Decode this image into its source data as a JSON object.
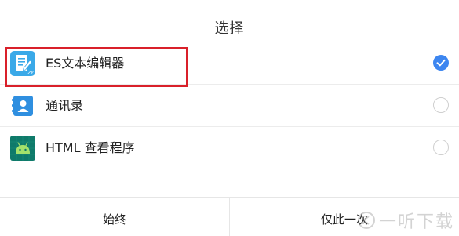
{
  "dialog": {
    "title": "选择"
  },
  "apps": [
    {
      "label": "ES文本编辑器",
      "icon": "es-text-editor-icon",
      "selected": true
    },
    {
      "label": "通讯录",
      "icon": "contacts-icon",
      "selected": false
    },
    {
      "label": "HTML 查看程序",
      "icon": "android-html-viewer-icon",
      "selected": false
    }
  ],
  "footer": {
    "always_label": "始终",
    "once_label": "仅此一次"
  },
  "watermark": {
    "text": "一听下载"
  },
  "colors": {
    "accent": "#3d86f0",
    "highlight_border": "#d9202a",
    "es_icon_bg": "#3aa9e8",
    "contacts_icon_bg": "#2f8fe0",
    "android_icon_bg": "#0f7a6a"
  }
}
